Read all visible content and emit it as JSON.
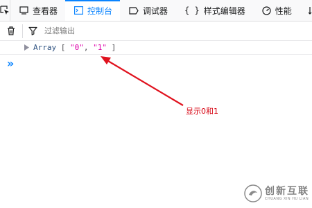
{
  "toolbar": {
    "tabs": [
      {
        "label": "查看器",
        "icon": "inspector-icon"
      },
      {
        "label": "控制台",
        "icon": "console-icon",
        "selected": true
      },
      {
        "label": "调试器",
        "icon": "debugger-icon"
      },
      {
        "label": "样式编辑器",
        "icon": "style-editor-icon"
      },
      {
        "label": "性能",
        "icon": "performance-icon"
      }
    ]
  },
  "filter": {
    "placeholder": "过滤输出"
  },
  "log": {
    "type": "Array",
    "open": "[",
    "item0": "\"0\"",
    "sep": ",",
    "item1": "\"1\"",
    "close": "]"
  },
  "input": {
    "prompt": "»"
  },
  "annotation": {
    "text": "显示0和1",
    "color": "#d7000f"
  },
  "watermark": {
    "name": "创新互联",
    "sub": "CHUANG XIN HU LIAN"
  },
  "colors": {
    "accent": "#0a84ff",
    "string": "#dd00a9"
  }
}
